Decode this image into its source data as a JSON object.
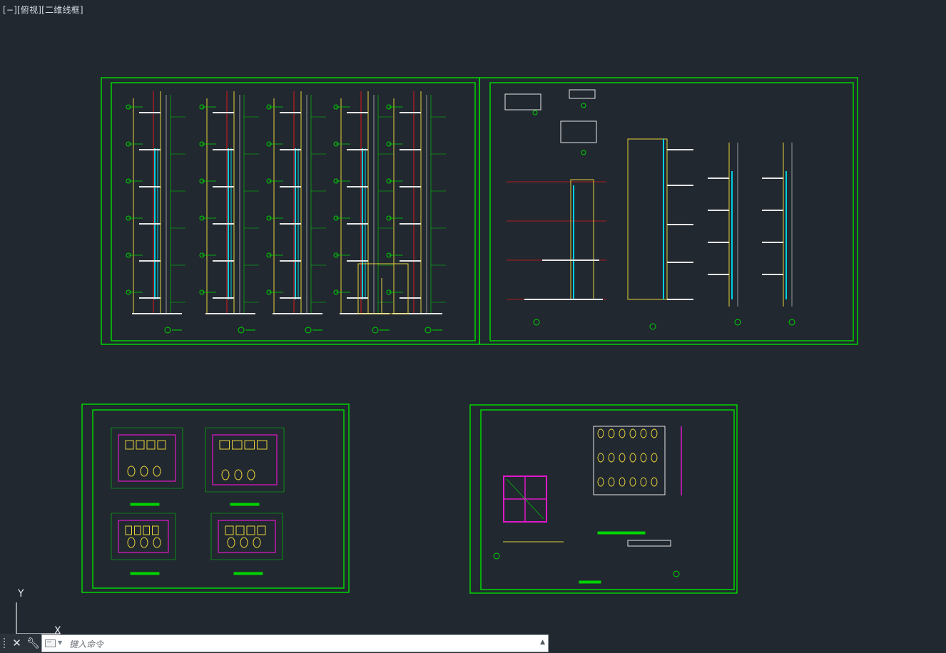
{
  "viewport": {
    "label": "[−][俯视][二维线框]"
  },
  "ucs": {
    "y_label": "Y",
    "x_label": "X"
  },
  "command_line": {
    "placeholder": "键入命令",
    "close_icon": "close-icon",
    "customize_icon": "wrench-icon"
  },
  "colors": {
    "background": "#212830",
    "frame_green": "#00d400",
    "wall_yellow": "#e8d23a",
    "glass_cyan": "#00cfe0",
    "axis_red": "#e01818",
    "fixture_magenta": "#e018c8",
    "dim_white": "#e6e6e6"
  }
}
